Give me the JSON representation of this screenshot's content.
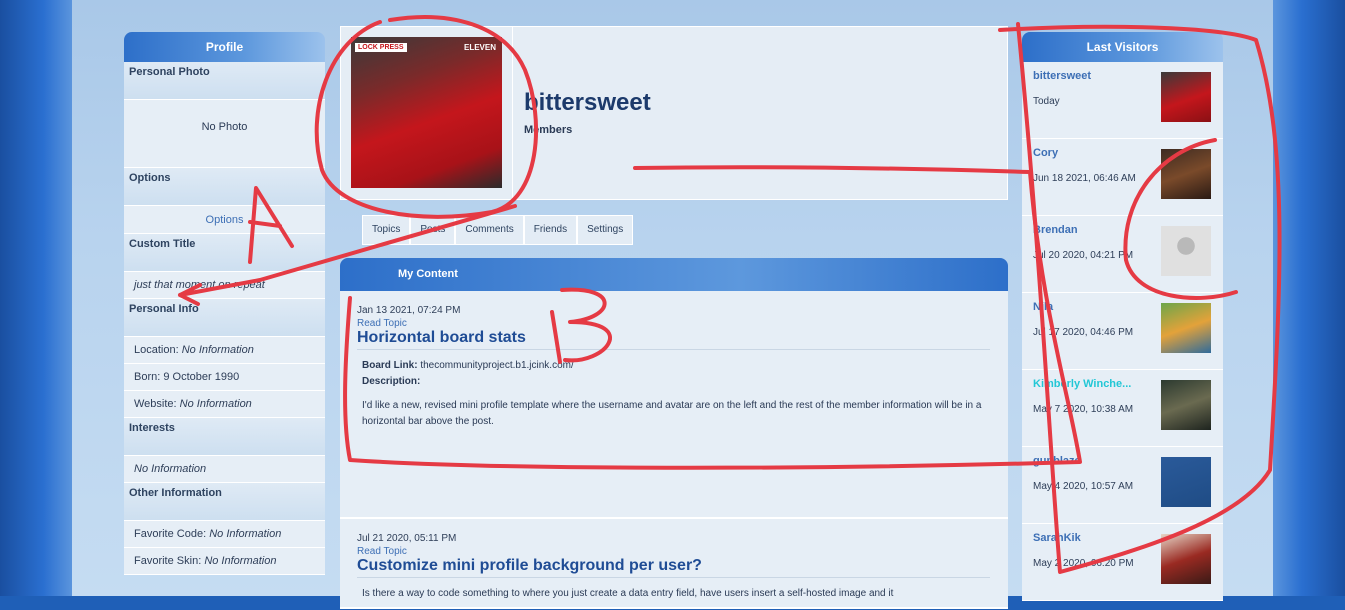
{
  "profile_sidebar": {
    "header": "Profile",
    "personal_photo": {
      "title": "Personal Photo",
      "value": "No Photo"
    },
    "options": {
      "title": "Options",
      "link": "Options"
    },
    "custom_title": {
      "title": "Custom Title",
      "value": "just that moment on repeat"
    },
    "personal_info": {
      "title": "Personal Info",
      "rows": [
        {
          "label": "Location: ",
          "value": "No Information"
        },
        {
          "label": "Born: ",
          "value": "9 October 1990"
        },
        {
          "label": "Website: ",
          "value": "No Information"
        }
      ]
    },
    "interests": {
      "title": "Interests",
      "value": "No Information"
    },
    "other_information": {
      "title": "Other Information",
      "rows": [
        {
          "label": "Favorite Code: ",
          "value": "No Information"
        },
        {
          "label": "Favorite Skin: ",
          "value": "No Information"
        }
      ]
    }
  },
  "profile": {
    "username": "bittersweet",
    "group": "Members",
    "avatar_badge": "LOCK PRESS",
    "avatar_badge2": "ELEVEN"
  },
  "tabs": [
    "Topics",
    "Posts",
    "Comments",
    "Friends",
    "Settings"
  ],
  "content": {
    "header": "My Content",
    "posts": [
      {
        "date": "Jan 13 2021, 07:24 PM",
        "read_topic": "Read Topic",
        "title": "Horizontal board stats",
        "board_link_label": "Board Link:",
        "board_link": "thecommunityproject.b1.jcink.com/",
        "description_label": "Description:",
        "body": "I'd like a new, revised mini profile template where the username and avatar are on the left and the rest of the member information will be in a horizontal bar above the post."
      },
      {
        "date": "Jul 21 2020, 05:11 PM",
        "read_topic": "Read Topic",
        "title": "Customize mini profile background per user?",
        "body": "Is there a way to code something to where you just create a data entry field, have users insert a self-hosted image and it"
      }
    ]
  },
  "last_visitors": {
    "header": "Last Visitors",
    "items": [
      {
        "name": "bittersweet",
        "date": "Today",
        "color": "#3d6fb5",
        "avatar": "photo-red"
      },
      {
        "name": "Cory",
        "date": "Jun 18 2021, 06:46 AM",
        "color": "#3d6fb5",
        "avatar": "game-art"
      },
      {
        "name": "Brendan",
        "date": "Jul 20 2020, 04:21 PM",
        "color": "#3d6fb5",
        "avatar": "default-user"
      },
      {
        "name": "Nila",
        "date": "Jul 17 2020, 04:46 PM",
        "color": "#3d6fb5",
        "avatar": "lion"
      },
      {
        "name": "Kimberly Winche...",
        "date": "May 7 2020, 10:38 AM",
        "color": "#22c7d6",
        "avatar": "group-photo"
      },
      {
        "name": "gunblaze",
        "date": "May 4 2020, 10:57 AM",
        "color": "#3d6fb5",
        "avatar": "logo-a"
      },
      {
        "name": "SarahKik",
        "date": "May 2 2020, 06:20 PM",
        "color": "#3d6fb5",
        "avatar": "portrait"
      }
    ]
  },
  "annotations": {
    "label_a": "A",
    "label_b": "B"
  }
}
